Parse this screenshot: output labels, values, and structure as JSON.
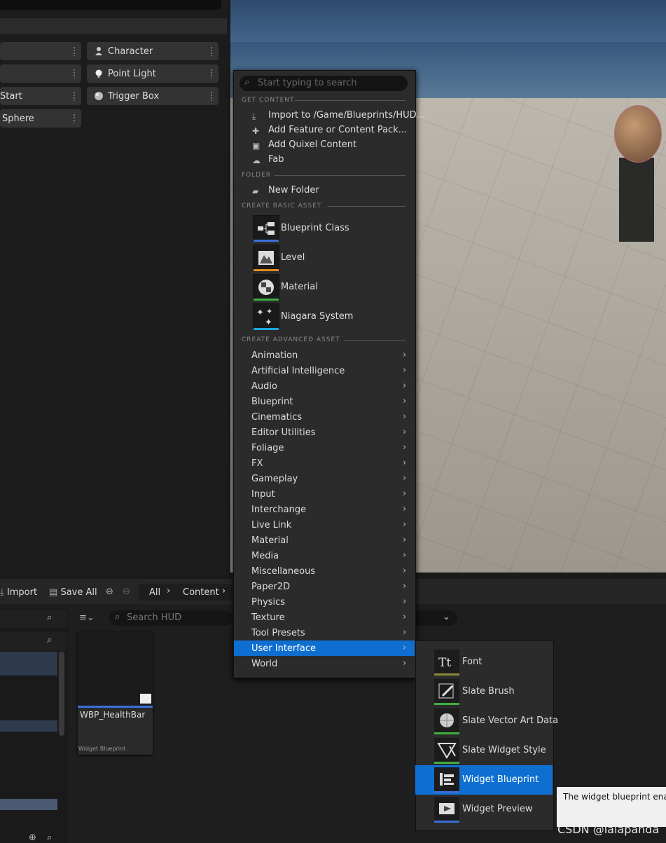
{
  "place_actors": {
    "tiles": [
      {
        "label": "Character",
        "icon": "character-icon"
      },
      {
        "label": "Point Light",
        "icon": "point-light-icon"
      },
      {
        "label": "Start",
        "icon": ""
      },
      {
        "label": "Trigger Box",
        "icon": "trigger-box-icon"
      },
      {
        "label": "Sphere",
        "icon": ""
      }
    ]
  },
  "context_menu": {
    "search_placeholder": "Start typing to search",
    "sections": {
      "get_content": "GET CONTENT",
      "folder": "FOLDER",
      "create_basic": "CREATE BASIC ASSET",
      "create_advanced": "CREATE ADVANCED ASSET"
    },
    "get_content_items": [
      {
        "label": "Import to /Game/Blueprints/HUD...",
        "icon": "import-icon"
      },
      {
        "label": "Add Feature or Content Pack...",
        "icon": "content-pack-icon"
      },
      {
        "label": "Add Quixel Content",
        "icon": "quixel-icon"
      },
      {
        "label": "Fab",
        "icon": "fab-icon"
      }
    ],
    "folder_items": [
      {
        "label": "New Folder",
        "icon": "new-folder-icon"
      }
    ],
    "basic_assets": [
      {
        "label": "Blueprint Class",
        "icon": "blueprint-class-icon",
        "color": "#3b6fd9"
      },
      {
        "label": "Level",
        "icon": "level-icon",
        "color": "#e08a1e"
      },
      {
        "label": "Material",
        "icon": "material-icon",
        "color": "#3fae3f"
      },
      {
        "label": "Niagara System",
        "icon": "niagara-icon",
        "color": "#1fa6d8"
      }
    ],
    "advanced_assets": [
      "Animation",
      "Artificial Intelligence",
      "Audio",
      "Blueprint",
      "Cinematics",
      "Editor Utilities",
      "Foliage",
      "FX",
      "Gameplay",
      "Input",
      "Interchange",
      "Live Link",
      "Material",
      "Media",
      "Miscellaneous",
      "Paper2D",
      "Physics",
      "Texture",
      "Tool Presets",
      "User Interface",
      "World"
    ],
    "highlighted_advanced": "User Interface"
  },
  "submenu": {
    "items": [
      {
        "label": "Font",
        "icon": "font-icon",
        "color": "#8a8a3a"
      },
      {
        "label": "Slate Brush",
        "icon": "slate-brush-icon",
        "color": "#3fae3f"
      },
      {
        "label": "Slate Vector Art Data",
        "icon": "slate-vector-icon",
        "color": "#3fae3f"
      },
      {
        "label": "Slate Widget Style",
        "icon": "slate-widget-style-icon",
        "color": "#3fae3f"
      },
      {
        "label": "Widget Blueprint",
        "icon": "widget-blueprint-icon",
        "color": "#3b6fd9"
      },
      {
        "label": "Widget Preview",
        "icon": "widget-preview-icon",
        "color": "#3b6fd9"
      }
    ],
    "highlighted": "Widget Blueprint"
  },
  "tooltip": {
    "text": "The widget blueprint enable"
  },
  "content_browser": {
    "import_label": "Import",
    "save_all_label": "Save All",
    "breadcrumb": [
      "All",
      "Content"
    ],
    "search_placeholder": "Search HUD",
    "asset": {
      "name": "WBP_HealthBar",
      "type": "Widget Blueprint",
      "color": "#3b6fd9"
    }
  },
  "watermark": "CSDN @lalapanda"
}
